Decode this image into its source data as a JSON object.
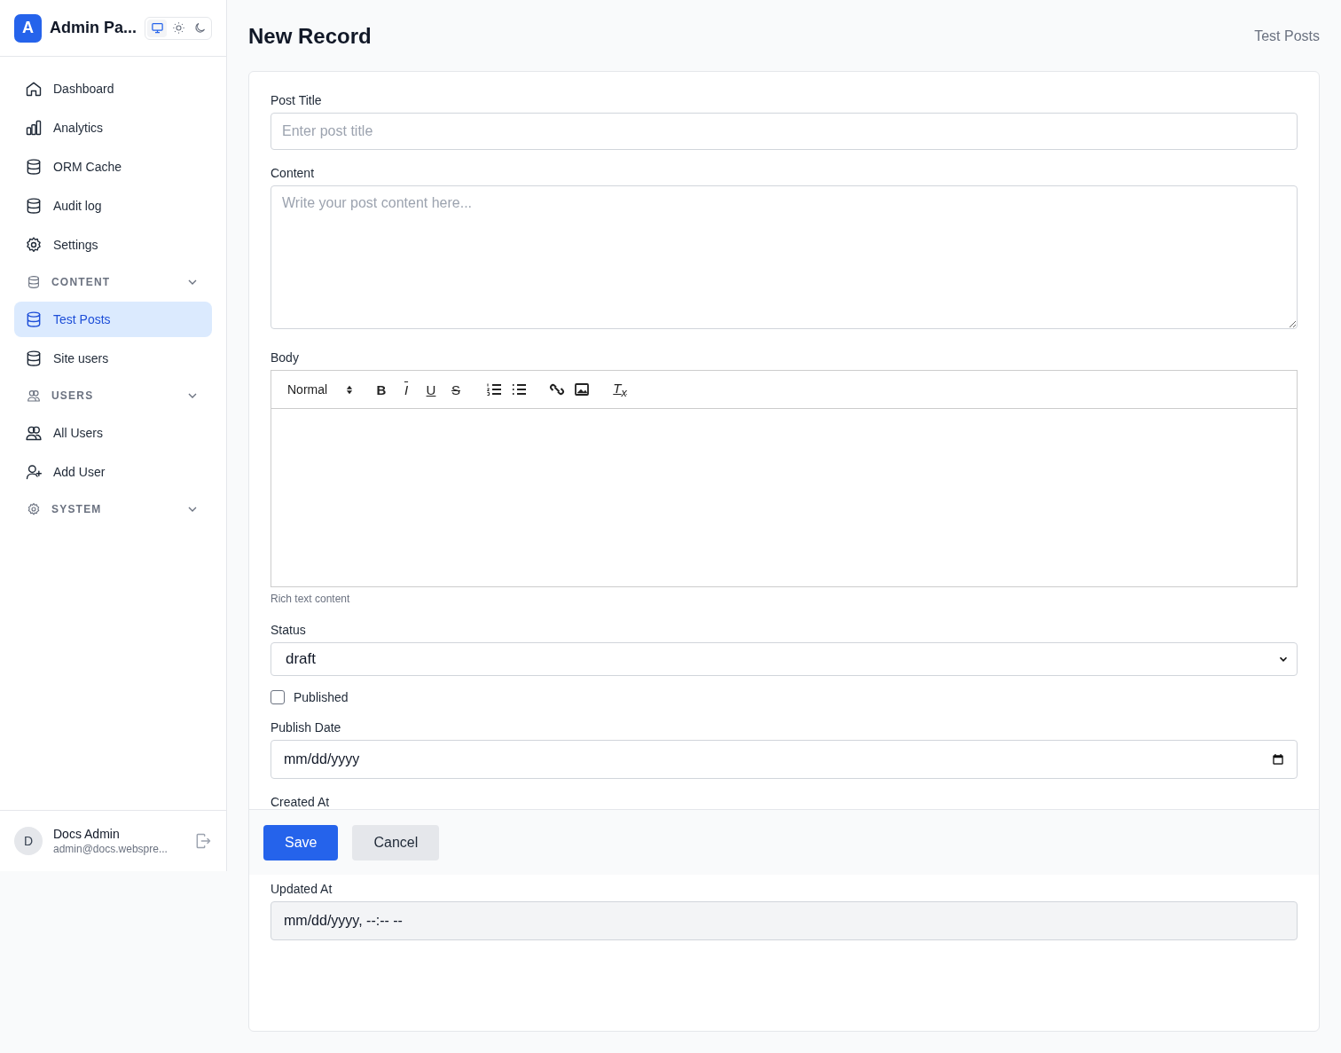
{
  "app": {
    "logo_letter": "A",
    "title": "Admin Pa...",
    "theme_modes": [
      {
        "kind": "system",
        "selected": true
      },
      {
        "kind": "light",
        "selected": false
      },
      {
        "kind": "dark",
        "selected": false
      }
    ]
  },
  "nav": [
    {
      "kind": "item",
      "label": "Dashboard",
      "selected": false
    },
    {
      "kind": "item",
      "label": "Analytics",
      "selected": false
    },
    {
      "kind": "item",
      "label": "ORM Cache",
      "selected": false
    },
    {
      "kind": "item",
      "label": "Audit log",
      "selected": false
    },
    {
      "kind": "item",
      "label": "Settings",
      "selected": false
    },
    {
      "kind": "section",
      "label": "CONTENT"
    },
    {
      "kind": "item",
      "label": "Test Posts",
      "selected": true
    },
    {
      "kind": "item",
      "label": "Site users",
      "selected": false
    },
    {
      "kind": "section",
      "label": "USERS"
    },
    {
      "kind": "item",
      "label": "All Users",
      "selected": false
    },
    {
      "kind": "item",
      "label": "Add User",
      "selected": false
    },
    {
      "kind": "section",
      "label": "SYSTEM"
    }
  ],
  "user": {
    "initial": "D",
    "name": "Docs Admin",
    "email": "admin@docs.webspre..."
  },
  "page": {
    "title": "New Record",
    "breadcrumb": "Test Posts"
  },
  "form": {
    "fields": [
      {
        "kind": "text",
        "label": "Post Title",
        "placeholder": "Enter post title"
      },
      {
        "kind": "textarea",
        "label": "Content",
        "placeholder": "Write your post content here..."
      },
      {
        "kind": "richtext",
        "label": "Body",
        "format": "Normal",
        "help": "Rich text content",
        "tools": [
          {
            "kind": "bold",
            "glyph": "B"
          },
          {
            "kind": "italic",
            "glyph": "I"
          },
          {
            "kind": "underline",
            "glyph": "U"
          },
          {
            "kind": "strike",
            "glyph": "S"
          },
          {
            "kind": "ordered-list"
          },
          {
            "kind": "bullet-list"
          },
          {
            "kind": "link"
          },
          {
            "kind": "image"
          },
          {
            "kind": "clean",
            "glyph": "T$_{x}$"
          }
        ]
      },
      {
        "kind": "select",
        "label": "Status",
        "value": "draft"
      },
      {
        "kind": "checkbox",
        "label": "Published",
        "checked": false
      },
      {
        "kind": "date",
        "label": "Publish Date",
        "value": "mm/dd/yyyy"
      },
      {
        "kind": "label",
        "label": "Created At"
      }
    ],
    "actions": [
      {
        "kind": "primary",
        "label": "Save"
      },
      {
        "kind": "secondary",
        "label": "Cancel"
      }
    ],
    "after_fields": [
      {
        "kind": "datetime",
        "label": "Updated At",
        "value": "mm/dd/yyyy, --:-- --",
        "disabled": true
      }
    ]
  }
}
